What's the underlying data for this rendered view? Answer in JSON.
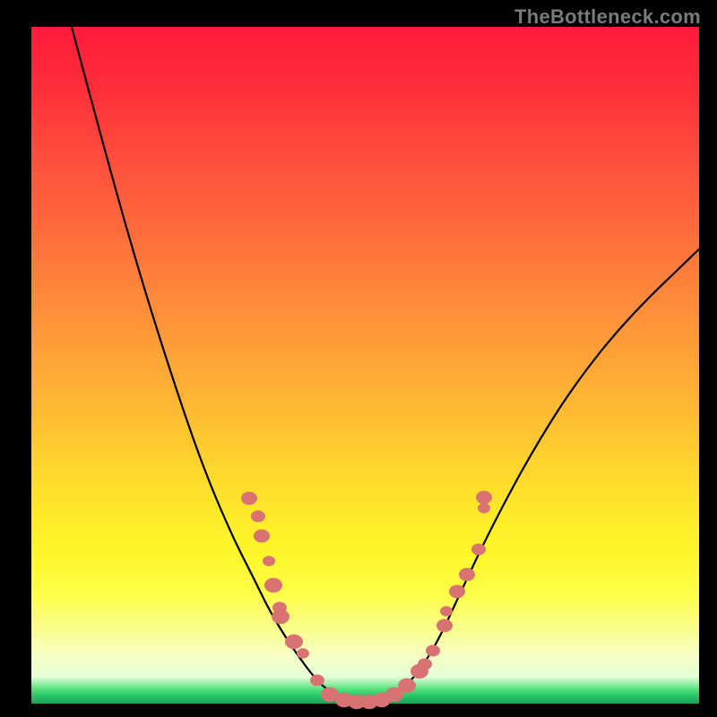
{
  "watermark": "TheBottleneck.com",
  "colors": {
    "page_bg": "#000000",
    "curve": "#000000",
    "marker": "#d97372"
  },
  "chart_data": {
    "type": "line",
    "title": "",
    "xlabel": "",
    "ylabel": "",
    "xlim": [
      35,
      780
    ],
    "ylim": [
      785,
      30
    ],
    "curve": [
      {
        "x": 80,
        "y": 30
      },
      {
        "x": 120,
        "y": 180
      },
      {
        "x": 160,
        "y": 320
      },
      {
        "x": 200,
        "y": 445
      },
      {
        "x": 230,
        "y": 530
      },
      {
        "x": 260,
        "y": 600
      },
      {
        "x": 283,
        "y": 645
      },
      {
        "x": 300,
        "y": 680
      },
      {
        "x": 318,
        "y": 710
      },
      {
        "x": 335,
        "y": 735
      },
      {
        "x": 350,
        "y": 755
      },
      {
        "x": 365,
        "y": 770
      },
      {
        "x": 380,
        "y": 778
      },
      {
        "x": 395,
        "y": 782
      },
      {
        "x": 408,
        "y": 783
      },
      {
        "x": 420,
        "y": 782
      },
      {
        "x": 435,
        "y": 778
      },
      {
        "x": 450,
        "y": 768
      },
      {
        "x": 465,
        "y": 752
      },
      {
        "x": 480,
        "y": 730
      },
      {
        "x": 495,
        "y": 702
      },
      {
        "x": 512,
        "y": 665
      },
      {
        "x": 545,
        "y": 595
      },
      {
        "x": 590,
        "y": 510
      },
      {
        "x": 640,
        "y": 430
      },
      {
        "x": 700,
        "y": 355
      },
      {
        "x": 780,
        "y": 278
      }
    ],
    "markers": [
      {
        "x": 278,
        "y": 556,
        "r": 9
      },
      {
        "x": 288,
        "y": 576,
        "r": 8
      },
      {
        "x": 292,
        "y": 598,
        "r": 9
      },
      {
        "x": 300,
        "y": 626,
        "r": 7
      },
      {
        "x": 305,
        "y": 653,
        "r": 10
      },
      {
        "x": 312,
        "y": 678,
        "r": 8
      },
      {
        "x": 313,
        "y": 688,
        "r": 10
      },
      {
        "x": 328,
        "y": 716,
        "r": 10
      },
      {
        "x": 338,
        "y": 729,
        "r": 7
      },
      {
        "x": 354,
        "y": 759,
        "r": 8
      },
      {
        "x": 368,
        "y": 775,
        "r": 10
      },
      {
        "x": 384,
        "y": 781,
        "r": 10
      },
      {
        "x": 398,
        "y": 783,
        "r": 10
      },
      {
        "x": 412,
        "y": 783,
        "r": 10
      },
      {
        "x": 426,
        "y": 781,
        "r": 10
      },
      {
        "x": 440,
        "y": 775,
        "r": 10
      },
      {
        "x": 454,
        "y": 765,
        "r": 10
      },
      {
        "x": 468,
        "y": 749,
        "r": 10
      },
      {
        "x": 474,
        "y": 741,
        "r": 8
      },
      {
        "x": 483,
        "y": 726,
        "r": 8
      },
      {
        "x": 496,
        "y": 698,
        "r": 9
      },
      {
        "x": 498,
        "y": 682,
        "r": 7
      },
      {
        "x": 510,
        "y": 660,
        "r": 9
      },
      {
        "x": 521,
        "y": 641,
        "r": 9
      },
      {
        "x": 534,
        "y": 613,
        "r": 8
      },
      {
        "x": 540,
        "y": 567,
        "r": 7
      },
      {
        "x": 540,
        "y": 555,
        "r": 9
      }
    ]
  }
}
